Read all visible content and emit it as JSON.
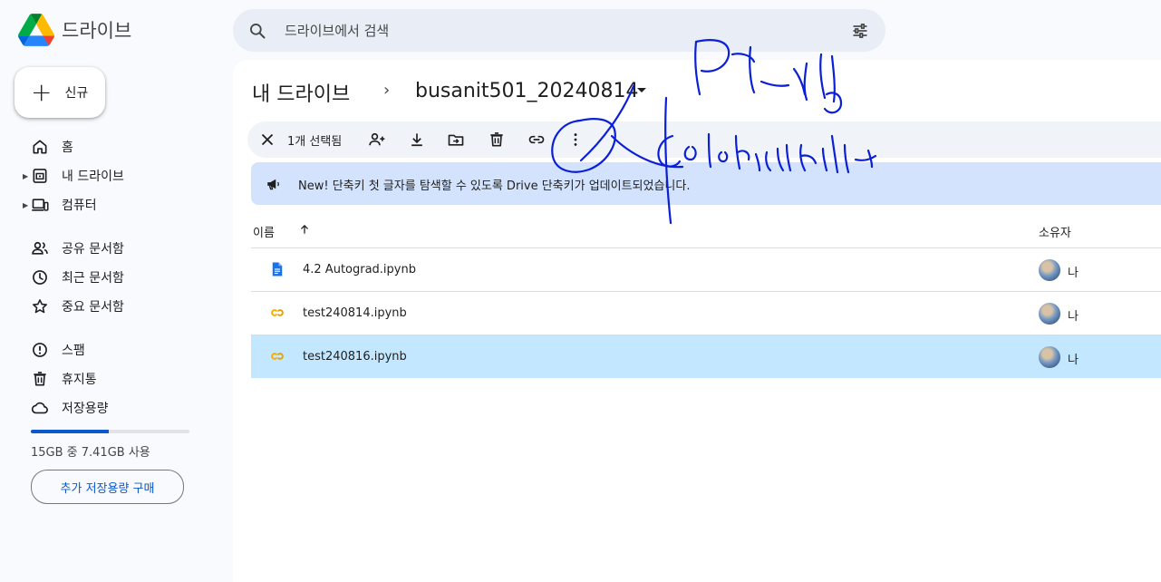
{
  "app": {
    "name": "드라이브",
    "logo": "google-drive-logo"
  },
  "search": {
    "placeholder": "드라이브에서 검색",
    "icon": "search-icon",
    "filter_icon": "tune-icon"
  },
  "sidebar": {
    "new_label": "신규",
    "items": [
      {
        "label": "홈",
        "icon": "home-icon",
        "has_caret": false
      },
      {
        "label": "내 드라이브",
        "icon": "my-drive-icon",
        "has_caret": true
      },
      {
        "label": "컴퓨터",
        "icon": "computers-icon",
        "has_caret": true
      },
      {
        "label": "공유 문서함",
        "icon": "shared-icon",
        "has_caret": false
      },
      {
        "label": "최근 문서함",
        "icon": "recent-icon",
        "has_caret": false
      },
      {
        "label": "중요 문서함",
        "icon": "star-icon",
        "has_caret": false
      },
      {
        "label": "스팸",
        "icon": "spam-icon",
        "has_caret": false
      },
      {
        "label": "휴지통",
        "icon": "trash-icon",
        "has_caret": false
      },
      {
        "label": "저장용량",
        "icon": "cloud-icon",
        "has_caret": false
      }
    ],
    "storage": {
      "used_fraction": 0.494,
      "text": "15GB 중 7.41GB 사용"
    },
    "buy_label": "추가 저장용량 구매"
  },
  "breadcrumb": {
    "root": "내 드라이브",
    "separator": "›",
    "current": "busanit501_20240814"
  },
  "selection_bar": {
    "count_label": "1개 선택됨",
    "actions": [
      "close-icon",
      "share-icon",
      "download-icon",
      "move-icon",
      "trash-icon",
      "link-icon",
      "more-vert-icon"
    ]
  },
  "banner": {
    "text": "New! 단축키 첫 글자를 탐색할 수 있도록 Drive 단축키가 업데이트되었습니다."
  },
  "columns": {
    "name": "이름",
    "owner": "소유자"
  },
  "files": [
    {
      "name": "4.2 Autograd.ipynb",
      "owner": "나",
      "icon": "doc-icon",
      "selected": false
    },
    {
      "name": "test240814.ipynb",
      "owner": "나",
      "icon": "colab-icon",
      "selected": false
    },
    {
      "name": "test240816.ipynb",
      "owner": "나",
      "icon": "colab-icon",
      "selected": true
    }
  ],
  "colors": {
    "accent": "#0b57d0",
    "selected_row": "#c2e7ff",
    "banner": "#d3e3fd",
    "ink": "#0a1fd6",
    "colab": "#f9ab00"
  }
}
